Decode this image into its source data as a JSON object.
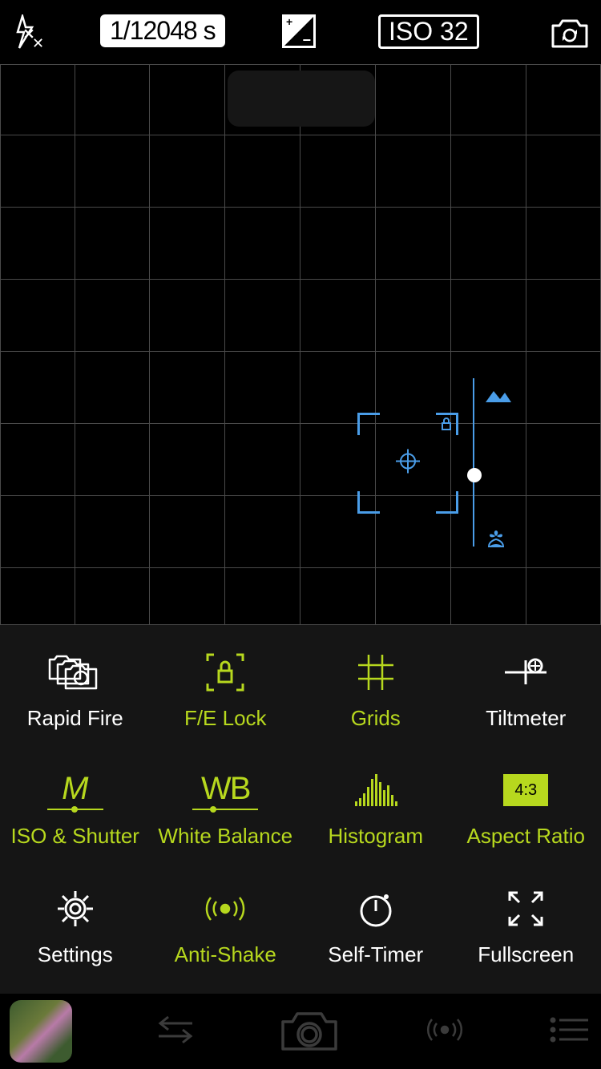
{
  "top": {
    "shutter_speed": "1/12048 s",
    "iso_label": "ISO 32"
  },
  "tools": {
    "rapid_fire": "Rapid Fire",
    "fe_lock": "F/E Lock",
    "grids": "Grids",
    "tiltmeter": "Tiltmeter",
    "iso_shutter": "ISO & Shutter",
    "white_balance": "White Balance",
    "histogram": "Histogram",
    "aspect_ratio": "Aspect Ratio",
    "aspect_ratio_value": "4:3",
    "settings": "Settings",
    "anti_shake": "Anti-Shake",
    "self_timer": "Self-Timer",
    "fullscreen": "Fullscreen"
  }
}
